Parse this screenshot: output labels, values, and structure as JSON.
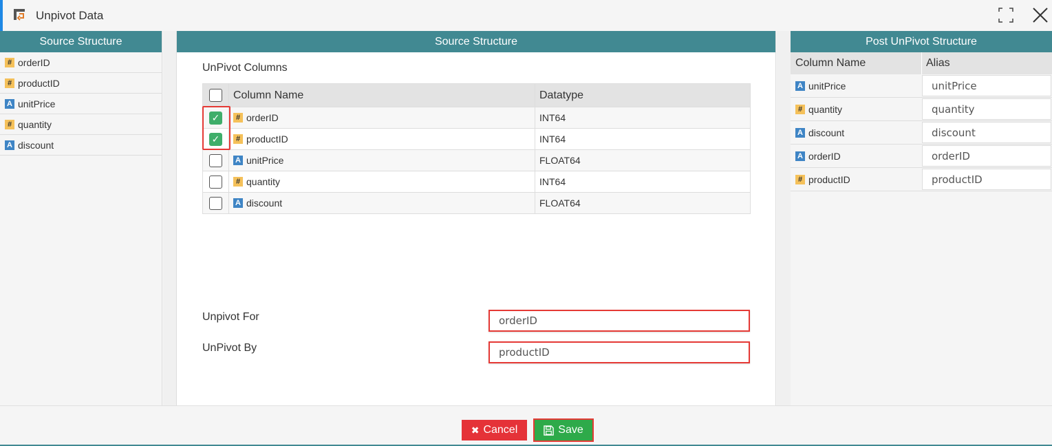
{
  "window": {
    "title": "Unpivot Data"
  },
  "left_panel": {
    "header": "Source Structure",
    "items": [
      {
        "type": "#",
        "label": "orderID"
      },
      {
        "type": "#",
        "label": "productID"
      },
      {
        "type": "A",
        "label": "unitPrice"
      },
      {
        "type": "#",
        "label": "quantity"
      },
      {
        "type": "A",
        "label": "discount"
      }
    ]
  },
  "middle_panel": {
    "header": "Source Structure",
    "unpivot_columns_label": "UnPivot Columns",
    "grid": {
      "col_name_header": "Column Name",
      "datatype_header": "Datatype",
      "rows": [
        {
          "checked": true,
          "type": "#",
          "name": "orderID",
          "datatype": "INT64"
        },
        {
          "checked": true,
          "type": "#",
          "name": "productID",
          "datatype": "INT64"
        },
        {
          "checked": false,
          "type": "A",
          "name": "unitPrice",
          "datatype": "FLOAT64"
        },
        {
          "checked": false,
          "type": "#",
          "name": "quantity",
          "datatype": "INT64"
        },
        {
          "checked": false,
          "type": "A",
          "name": "discount",
          "datatype": "FLOAT64"
        }
      ]
    },
    "unpivot_for_label": "Unpivot For",
    "unpivot_for_value": "orderID",
    "unpivot_by_label": "UnPivot By",
    "unpivot_by_value": "productID"
  },
  "right_panel": {
    "header": "Post UnPivot Structure",
    "col_name_header": "Column Name",
    "alias_header": "Alias",
    "rows": [
      {
        "type": "A",
        "name": "unitPrice",
        "alias": "unitPrice"
      },
      {
        "type": "#",
        "name": "quantity",
        "alias": "quantity"
      },
      {
        "type": "A",
        "name": "discount",
        "alias": "discount"
      },
      {
        "type": "A",
        "name": "orderID",
        "alias": "orderID"
      },
      {
        "type": "#",
        "name": "productID",
        "alias": "productID"
      }
    ]
  },
  "footer": {
    "cancel_label": "Cancel",
    "save_label": "Save"
  },
  "colors": {
    "header_teal": "#418992",
    "cancel_red": "#e53238",
    "save_green": "#2eaa4a",
    "highlight_red": "#e53935",
    "check_green": "#3fae6a"
  }
}
